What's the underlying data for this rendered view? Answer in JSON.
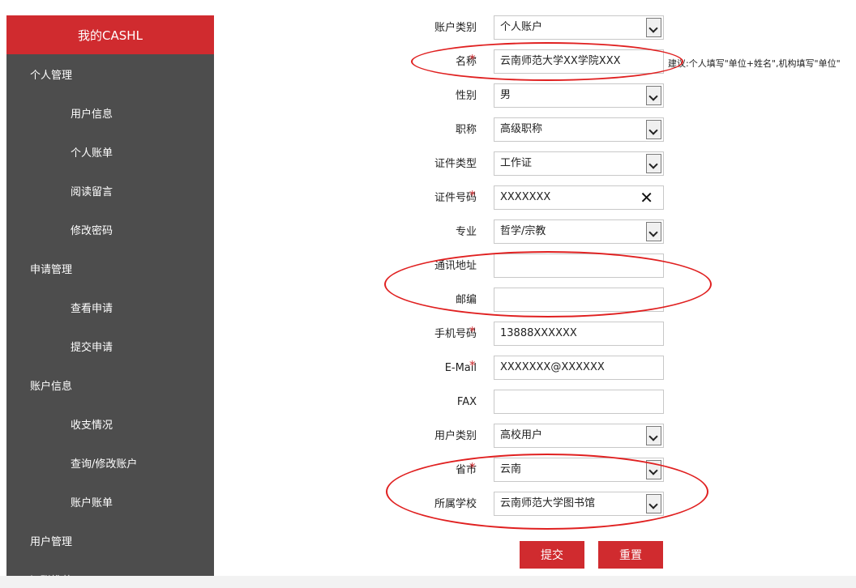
{
  "sidebar": {
    "title": "我的CASHL",
    "items": [
      {
        "label": "个人管理",
        "level": "category"
      },
      {
        "label": "用户信息",
        "level": "sub"
      },
      {
        "label": "个人账单",
        "level": "sub"
      },
      {
        "label": "阅读留言",
        "level": "sub"
      },
      {
        "label": "修改密码",
        "level": "sub"
      },
      {
        "label": "申请管理",
        "level": "category"
      },
      {
        "label": "查看申请",
        "level": "sub"
      },
      {
        "label": "提交申请",
        "level": "sub"
      },
      {
        "label": "账户信息",
        "level": "category"
      },
      {
        "label": "收支情况",
        "level": "sub"
      },
      {
        "label": "查询/修改账户",
        "level": "sub"
      },
      {
        "label": "账户账单",
        "level": "sub"
      },
      {
        "label": "用户管理",
        "level": "category"
      },
      {
        "label": "证联推荐",
        "level": "category"
      }
    ]
  },
  "form": {
    "account_type": {
      "label": "账户类别",
      "value": "个人账户"
    },
    "name": {
      "label": "名称",
      "required": "*",
      "value": "云南师范大学XX学院XXX",
      "hint": "建议:个人填写\"单位+姓名\",机构填写\"单位\""
    },
    "gender": {
      "label": "性别",
      "value": "男"
    },
    "title": {
      "label": "职称",
      "value": "高级职称"
    },
    "id_type": {
      "label": "证件类型",
      "value": "工作证"
    },
    "id_number": {
      "label": "证件号码",
      "required": "*",
      "value": "XXXXXXX",
      "clear_icon": "✕"
    },
    "major": {
      "label": "专业",
      "value": "哲学/宗教"
    },
    "address": {
      "label": "通讯地址",
      "value": ""
    },
    "postcode": {
      "label": "邮编",
      "value": ""
    },
    "mobile": {
      "label": "手机号码",
      "required": "*",
      "value": "13888XXXXXX"
    },
    "email": {
      "label": "E-Mail",
      "required": "*",
      "value": "XXXXXXX@XXXXXX"
    },
    "fax": {
      "label": "FAX",
      "value": ""
    },
    "user_type": {
      "label": "用户类别",
      "value": "高校用户"
    },
    "province": {
      "label": "省市",
      "required": "*",
      "value": "云南"
    },
    "school": {
      "label": "所属学校",
      "value": "云南师范大学图书馆"
    }
  },
  "buttons": {
    "submit": "提交",
    "reset": "重置"
  },
  "colors": {
    "accent": "#d02b2f",
    "sidebar_bg": "#4d4d4d",
    "annotation": "#e02020"
  }
}
